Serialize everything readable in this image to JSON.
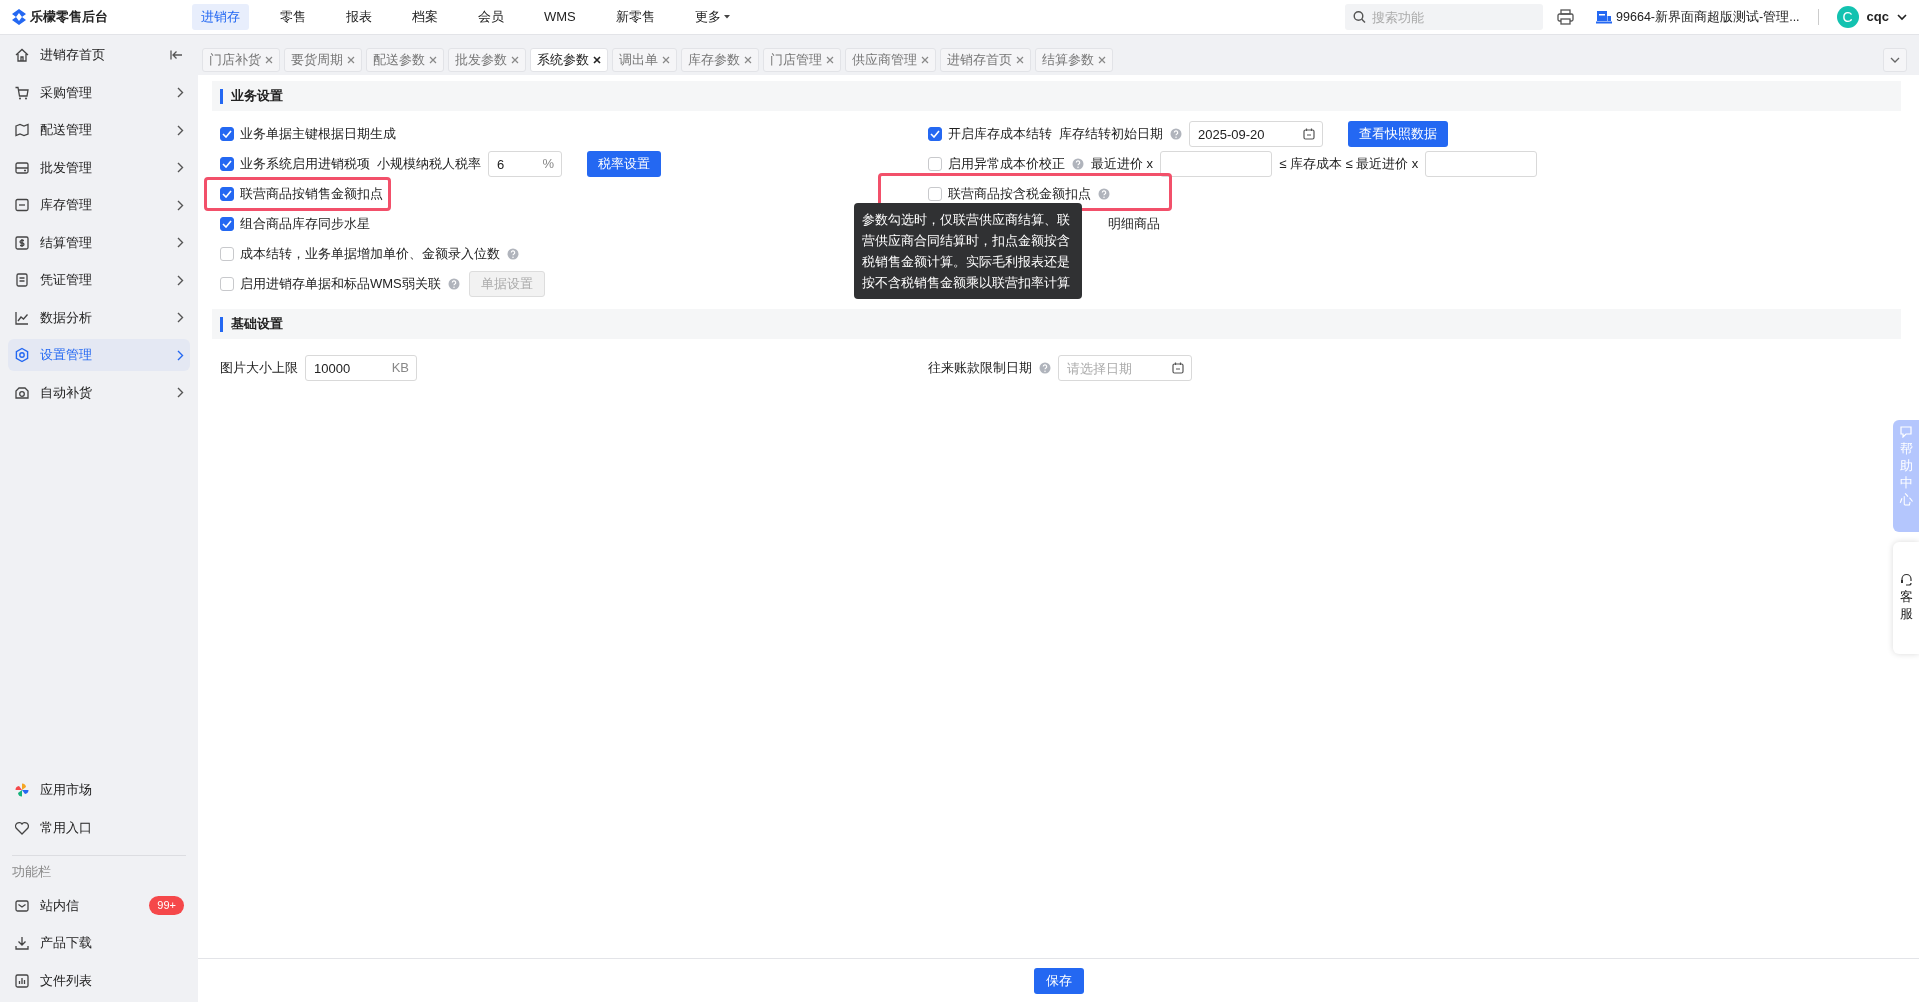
{
  "app": {
    "logo_text": "乐檬零售后台"
  },
  "top_nav": [
    {
      "label": "进销存",
      "selected": true,
      "has_caret": false
    },
    {
      "label": "零售",
      "selected": false,
      "has_caret": false
    },
    {
      "label": "报表",
      "selected": false,
      "has_caret": false
    },
    {
      "label": "档案",
      "selected": false,
      "has_caret": false
    },
    {
      "label": "会员",
      "selected": false,
      "has_caret": false
    },
    {
      "label": "WMS",
      "selected": false,
      "has_caret": false
    },
    {
      "label": "新零售",
      "selected": false,
      "has_caret": false
    },
    {
      "label": "更多",
      "selected": false,
      "has_caret": true
    }
  ],
  "search": {
    "placeholder": "搜索功能"
  },
  "store": "99664-新界面商超版测试-管理...",
  "user": {
    "avatar_letter": "C",
    "name": "cqc"
  },
  "sidebar": {
    "items": [
      {
        "label": "进销存首页",
        "kind": "home",
        "selected": false
      },
      {
        "label": "采购管理",
        "kind": "group",
        "selected": false
      },
      {
        "label": "配送管理",
        "kind": "group",
        "selected": false
      },
      {
        "label": "批发管理",
        "kind": "group",
        "selected": false
      },
      {
        "label": "库存管理",
        "kind": "group",
        "selected": false
      },
      {
        "label": "结算管理",
        "kind": "group",
        "selected": false
      },
      {
        "label": "凭证管理",
        "kind": "group",
        "selected": false
      },
      {
        "label": "数据分析",
        "kind": "group",
        "selected": false
      },
      {
        "label": "设置管理",
        "kind": "group",
        "selected": true
      },
      {
        "label": "自动补货",
        "kind": "group",
        "selected": false
      }
    ],
    "bottom_items": [
      {
        "label": "应用市场"
      },
      {
        "label": "常用入口"
      }
    ],
    "function_bar": {
      "title": "功能栏",
      "items": [
        {
          "label": "站内信",
          "badge": "99+"
        },
        {
          "label": "产品下载"
        },
        {
          "label": "文件列表"
        }
      ]
    }
  },
  "tabs": [
    {
      "label": "门店补货",
      "selected": false
    },
    {
      "label": "要货周期",
      "selected": false
    },
    {
      "label": "配送参数",
      "selected": false
    },
    {
      "label": "批发参数",
      "selected": false
    },
    {
      "label": "系统参数",
      "selected": true
    },
    {
      "label": "调出单",
      "selected": false
    },
    {
      "label": "库存参数",
      "selected": false
    },
    {
      "label": "门店管理",
      "selected": false
    },
    {
      "label": "供应商管理",
      "selected": false
    },
    {
      "label": "进销存首页",
      "selected": false
    },
    {
      "label": "结算参数",
      "selected": false
    }
  ],
  "sections": [
    {
      "title": "业务设置",
      "left": [
        {
          "highlighted": false,
          "parts": [
            {
              "kind": "checkbox",
              "checked": true,
              "label": "业务单据主键根据日期生成"
            }
          ]
        },
        {
          "highlighted": false,
          "parts": [
            {
              "kind": "checkbox",
              "checked": true,
              "label": "业务系统启用进销税项"
            },
            {
              "kind": "text",
              "text": "小规模纳税人税率"
            },
            {
              "kind": "input",
              "value": "6",
              "suffix": "%"
            },
            {
              "kind": "button",
              "label": "税率设置",
              "disabled": false
            }
          ]
        },
        {
          "highlighted": true,
          "parts": [
            {
              "kind": "checkbox",
              "checked": true,
              "label": "联营商品按销售金额扣点"
            }
          ]
        },
        {
          "highlighted": false,
          "parts": [
            {
              "kind": "checkbox",
              "checked": true,
              "label": "组合商品库存同步水星"
            }
          ]
        },
        {
          "highlighted": false,
          "parts": [
            {
              "kind": "checkbox",
              "checked": false,
              "label": "成本结转，业务单据增加单价、金额录入位数"
            },
            {
              "kind": "help"
            }
          ]
        },
        {
          "highlighted": false,
          "parts": [
            {
              "kind": "checkbox",
              "checked": false,
              "label": "启用进销存单据和标品WMS弱关联"
            },
            {
              "kind": "help"
            },
            {
              "kind": "button",
              "label": "单据设置",
              "disabled": true
            }
          ]
        }
      ],
      "right": [
        {
          "highlighted": false,
          "parts": [
            {
              "kind": "checkbox",
              "checked": true,
              "label": "开启库存成本结转"
            },
            {
              "kind": "text",
              "text": "库存结转初始日期"
            },
            {
              "kind": "help"
            },
            {
              "kind": "date",
              "value": "2025-09-20"
            },
            {
              "kind": "button",
              "label": "查看快照数据",
              "disabled": false
            }
          ]
        },
        {
          "highlighted": false,
          "parts": [
            {
              "kind": "checkbox",
              "checked": false,
              "label": "启用异常成本价校正"
            },
            {
              "kind": "help"
            },
            {
              "kind": "text",
              "text": "最近进价 x"
            },
            {
              "kind": "input"
            },
            {
              "kind": "text",
              "text": "≤ 库存成本 ≤ 最近进价 x"
            },
            {
              "kind": "input"
            }
          ]
        },
        {
          "highlighted": true,
          "parts": [
            {
              "kind": "checkbox",
              "checked": false,
              "label": "联营商品按含税金额扣点"
            },
            {
              "kind": "help"
            }
          ]
        },
        {
          "highlighted": false,
          "obscured": true,
          "parts": [
            {
              "kind": "text",
              "text": "明细商品"
            }
          ]
        }
      ],
      "tooltip": "参数勾选时，仅联营供应商结算、联营供应商合同结算时，扣点金额按含税销售金额计算。实际毛利报表还是按不含税销售金额乘以联营扣率计算"
    },
    {
      "title": "基础设置",
      "left": [
        {
          "highlighted": false,
          "parts": [
            {
              "kind": "text",
              "text": "图片大小上限"
            },
            {
              "kind": "input",
              "value": "10000",
              "suffix": "KB"
            }
          ]
        }
      ],
      "right": [
        {
          "highlighted": false,
          "parts": [
            {
              "kind": "text",
              "text": "往来账款限制日期"
            },
            {
              "kind": "help"
            },
            {
              "kind": "date",
              "placeholder": "请选择日期"
            }
          ]
        }
      ]
    }
  ],
  "footer": {
    "save": "保存"
  },
  "float": {
    "help": "帮助中心",
    "service": "客服"
  }
}
